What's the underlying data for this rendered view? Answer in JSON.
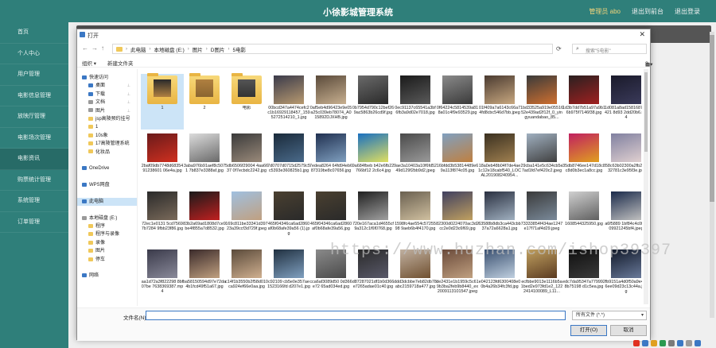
{
  "app": {
    "title": "小徐影城管理系统",
    "user_label": "管理员 abo",
    "back_label": "退出到前台",
    "logout_label": "退出登录"
  },
  "sidebar": {
    "items": [
      {
        "label": "首页"
      },
      {
        "label": "个人中心"
      },
      {
        "label": "用户管理"
      },
      {
        "label": "电影信息管理"
      },
      {
        "label": "放映厅管理"
      },
      {
        "label": "电影场次管理"
      },
      {
        "label": "电影资讯"
      },
      {
        "label": "购票统计管理"
      },
      {
        "label": "系统管理"
      },
      {
        "label": "订单管理"
      }
    ],
    "active_index": 6
  },
  "watermark": "https://www.huzhan.com/ishop39397",
  "dialog": {
    "title": "打开",
    "breadcrumb": [
      "此电脑",
      "本地磁盘 (E:)",
      "图片",
      "D图片",
      "5电影"
    ],
    "search_placeholder": "搜索\"5电影\"",
    "toolbar": {
      "organize": "组织 ▾",
      "new_folder": "新建文件夹"
    },
    "nav": [
      {
        "label": "快速访问",
        "color": "#3b78c4",
        "indent": 0,
        "pinned": false
      },
      {
        "label": "桌面",
        "color": "#3b78c4",
        "indent": 1,
        "pinned": true
      },
      {
        "label": "下载",
        "color": "#3b78c4",
        "indent": 1,
        "pinned": true
      },
      {
        "label": "文档",
        "color": "#9a9a9a",
        "indent": 1,
        "pinned": true
      },
      {
        "label": "图片",
        "color": "#9a9a9a",
        "indent": 1,
        "pinned": true
      },
      {
        "label": "jsp高陵预约挂号",
        "color": "#f0c85a",
        "indent": 1,
        "pinned": false
      },
      {
        "label": "1",
        "color": "#f0c85a",
        "indent": 1,
        "pinned": false
      },
      {
        "label": "10s象",
        "color": "#f0c85a",
        "indent": 1,
        "pinned": false
      },
      {
        "label": "17高陵管理系统",
        "color": "#f0c85a",
        "indent": 1,
        "pinned": false
      },
      {
        "label": "化妆品",
        "color": "#f0c85a",
        "indent": 1,
        "pinned": false
      },
      {
        "label": "",
        "color": "transparent",
        "indent": 0,
        "pinned": false
      },
      {
        "label": "OneDrive",
        "color": "#3b78c4",
        "indent": 0,
        "pinned": false
      },
      {
        "label": "",
        "color": "transparent",
        "indent": 0,
        "pinned": false
      },
      {
        "label": "WPS网盘",
        "color": "#3b78c4",
        "indent": 0,
        "pinned": false
      },
      {
        "label": "",
        "color": "transparent",
        "indent": 0,
        "pinned": false
      },
      {
        "label": "此电脑",
        "color": "#3b78c4",
        "indent": 0,
        "pinned": false,
        "selected": true
      },
      {
        "label": "",
        "color": "transparent",
        "indent": 0,
        "pinned": false
      },
      {
        "label": "本地磁盘 (E:)",
        "color": "#9a9a9a",
        "indent": 0,
        "pinned": false
      },
      {
        "label": "程序",
        "color": "#f0c85a",
        "indent": 1,
        "pinned": false
      },
      {
        "label": "程序与录像",
        "color": "#f0c85a",
        "indent": 1,
        "pinned": false
      },
      {
        "label": "录像",
        "color": "#f0c85a",
        "indent": 1,
        "pinned": false
      },
      {
        "label": "图片",
        "color": "#f0c85a",
        "indent": 1,
        "pinned": false
      },
      {
        "label": "停车",
        "color": "#f0c85a",
        "indent": 1,
        "pinned": false
      },
      {
        "label": "",
        "color": "transparent",
        "indent": 0,
        "pinned": false
      },
      {
        "label": "网络",
        "color": "#3b78c4",
        "indent": 0,
        "pinned": false
      }
    ],
    "files": [
      {
        "name": "1",
        "kind": "folder",
        "c1": "#2a2a2a",
        "c2": "#b08040"
      },
      {
        "name": "2",
        "kind": "folder",
        "c1": "#b08040",
        "c2": "#8a6530"
      },
      {
        "name": "电影",
        "kind": "folder",
        "c1": "#555555",
        "c2": "#333333"
      },
      {
        "name": "00bcd347a4474cefc2c1b16929118457_1595272514210_1.jpg",
        "c1": "#3a3a4a",
        "c2": "#b89a70"
      },
      {
        "name": "0af5eb4d96423e9e05a25c039eb78074_A015892DJXHB.jpg",
        "c1": "#5a4a3a",
        "c2": "#c8b090"
      },
      {
        "name": "0b7954d790c12bef269ac5863b26cd9f.jpg",
        "c1": "#6a6a6a",
        "c2": "#2a2a2a"
      },
      {
        "name": "0ec91137c65541a3bf6fb3a9d02e7018.jpg",
        "c1": "#1a1a1a",
        "c2": "#5a5a5a"
      },
      {
        "name": "0f64224c5814539a818a01c4f9e93529.jpg",
        "c1": "#8a8a8a",
        "c2": "#3a3a3a"
      },
      {
        "name": "01f409a7a6143c66a74fd8cbc546d7bb.jpeg",
        "c1": "#4a3a30",
        "c2": "#c8a880"
      },
      {
        "name": "1bd33525a919e0551652e439ad2f12f_0_yingyuandabao_85...",
        "c1": "#3a3a3a",
        "c2": "#d07030"
      },
      {
        "name": "1d3b7dd7b51a97a9b16b975f7146f38.jpg",
        "c1": "#2a2020",
        "c2": "#a02020"
      },
      {
        "name": "1d081a8ad1581687e8421 8d93 2dd20b6.mp4",
        "c1": "#1a1a2a",
        "c2": "#3a3a5a"
      },
      {
        "name": "2baf09db7748d6835491238601 06e4a.jpg",
        "c1": "#6a1a1a",
        "c2": "#d03020"
      },
      {
        "name": "3aba976b91aef8c5071 7b837e3388af.jpg",
        "c1": "#dcdcdc",
        "c2": "#6a6a6a"
      },
      {
        "name": "5db6506f29004 4aa6637 0f7ecbdc2242.jpg",
        "c1": "#3a3a3a",
        "c2": "#9a8a7a"
      },
      {
        "name": "7d0707d0715d2579c5c5393e360825b1.jpg",
        "c1": "#1a2a3a",
        "c2": "#4a6a8a"
      },
      {
        "name": "7edea8264 64fd94eb687319be8c07656.jpg",
        "c1": "#203050",
        "c2": "#80a0c0"
      },
      {
        "name": "9a684fbeb b42e6fb22766bf12 2c6c4.jpg",
        "c1": "#1a70c0",
        "c2": "#e0e060"
      },
      {
        "name": "9ae3a10403a10f6fd5249d129f2bb9d2.jpeg",
        "c1": "#4a4a4a",
        "c2": "#9a9a9a"
      },
      {
        "name": "16bfdd3b53814489e69a113f874c05.jpg",
        "c1": "#80a0c0",
        "c2": "#c08040"
      },
      {
        "name": "18a0eb48b04f7de4ae1c12e18cabf540_LOCAL201908240954...",
        "c1": "#3a3020",
        "c2": "#a08050"
      },
      {
        "name": "29cba141e5c634cb5e7ad1fd7ef420c2.jpeg",
        "c1": "#a0b0c0",
        "c2": "#404040"
      },
      {
        "name": "35db8746ee147d18c8c8d0b3ec1a8cc.jpg",
        "c1": "#c02060",
        "c2": "#e0a020"
      },
      {
        "name": "58c63b02300a2fb2d332781c3e95f3e.jpg",
        "c1": "#8080a0",
        "c2": "#e0d0d0"
      },
      {
        "name": "72ec1e0131 5cd75697b7284 9fbb23f86.jpg",
        "c1": "#2a2a2a",
        "c2": "#7a6a5a"
      },
      {
        "name": "83b2a69ad1808d7ce9be4f855a7d8532.jpg",
        "c1": "#1a1a1a",
        "c2": "#c02020"
      },
      {
        "name": "169c811be33341d39723a39ccf3d729f.jpeg",
        "c1": "#a0c0e0",
        "c2": "#c0a080"
      },
      {
        "name": "465f04346ca6ad2860af0b68afe39a56 (1).jpg",
        "c1": "#4a4030",
        "c2": "#2a2a2a"
      },
      {
        "name": "465f04346ca6ad2860af0b68afe39a56.jpg",
        "c1": "#4a4030",
        "c2": "#2a2a2a"
      },
      {
        "name": "720e167aca1d4655cf9a312c1f6f0768.jpg",
        "c1": "#202020",
        "c2": "#a0a0a0"
      },
      {
        "name": "1598fc4ae554c5725598 9aeb6b4f4170.jpg",
        "c1": "#6a6050",
        "c2": "#d0c0a0"
      },
      {
        "name": "82300d0224070ac3d2cc2e0d23c6f69.jpg",
        "c1": "#404060",
        "c2": "#c0a060"
      },
      {
        "name": "63588b8db3ca443cbb37a72a6628a1.jpg",
        "c1": "#2a3040",
        "c2": "#a0b0c0"
      },
      {
        "name": "73333854f434ae1247e17f71af4d29.jpeg",
        "c1": "#3a3a3a",
        "c2": "#7a8a9a"
      },
      {
        "name": "1608544325950.jpg",
        "c1": "#d0d0d0",
        "c2": "#606060"
      },
      {
        "name": "a6f5889 1bf84c4c0f8009921245bf4.jpeg",
        "c1": "#1a2a4a",
        "c2": "#c0c0c0"
      },
      {
        "name": "aa1d72a3f822298 8bf07be 7638369387.mp4",
        "c1": "#3a3a4a",
        "c2": "#8a8a9a"
      },
      {
        "name": "ba58150594d97e72da4b1fcd49f51a67.jpg",
        "c1": "#3a2a2a",
        "c2": "#c0a080"
      },
      {
        "name": "c14f1b3550b2f58d010ca924ef66e0aa.jpg",
        "c1": "#5a4a3a",
        "c2": "#d0b090"
      },
      {
        "name": "c92109 cb5e0e357ae1523166fd d207e1.jpg",
        "c1": "#203040",
        "c2": "#80a0c0"
      },
      {
        "name": "cca6af3089d50 0d366e72 65ad034ed.jpg",
        "c1": "#8a8a8a",
        "c2": "#4a4a4a"
      },
      {
        "name": "d87287021df1b0d366e7265adae01c40.jpg",
        "c1": "#2a2a2a",
        "c2": "#5a5a6a"
      },
      {
        "name": "ddd3dcbbe7eb82db78abc2159718a477.jpg",
        "c1": "#c0b0a0",
        "c2": "#705030"
      },
      {
        "name": "de2431e1b1959c5c619b3ba2feb9b8440_ex2009113101547.jpeg",
        "c1": "#6a4a3a",
        "c2": "#c0a080"
      },
      {
        "name": "e042123fd6300408e00b4a26b34fc3fd.jpg",
        "c1": "#3a5070",
        "c2": "#c0d0e0"
      },
      {
        "name": "ecfbbe9013e1116b5a1bed2e973fd1e2_1222414100089_L11...",
        "c1": "#c0a060",
        "c2": "#5a3a20"
      },
      {
        "name": "edc7da95347a7799928b75198 d1c5ea.jpg",
        "c1": "#101010",
        "c2": "#3a3a3a"
      },
      {
        "name": "fb9151a4d0f50a9e4ef6ee09d23c13c44a.jpeg",
        "c1": "#101828",
        "c2": "#6a7a9a"
      }
    ],
    "filename_label": "文件名(N):",
    "filename_value": "",
    "filetype_value": "所有文件 (*.*)",
    "open_label": "打开(O)",
    "cancel_label": "取消"
  },
  "tray_colors": [
    "#e03020",
    "#3b78c4",
    "#e0a020",
    "#2a9a50",
    "#7a7a7a",
    "#3b78c4",
    "#9a9a9a",
    "#3b78c4"
  ]
}
